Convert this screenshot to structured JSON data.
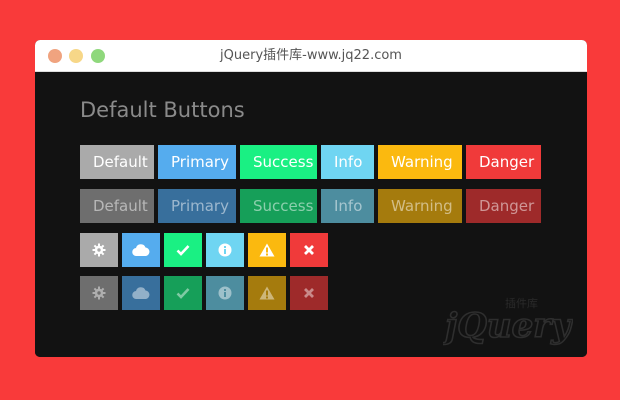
{
  "window": {
    "title": "jQuery插件库-www.jq22.com"
  },
  "heading": "Default Buttons",
  "buttons": [
    {
      "label": "Default",
      "color": "#aaaaaa"
    },
    {
      "label": "Primary",
      "color": "#55acee"
    },
    {
      "label": "Success",
      "color": "#1af083"
    },
    {
      "label": "Info",
      "color": "#6fd5f2"
    },
    {
      "label": "Warning",
      "color": "#fbb90f"
    },
    {
      "label": "Danger",
      "color": "#f03a3a"
    }
  ],
  "disabled_buttons": [
    {
      "label": "Default",
      "color": "#6e6e6e"
    },
    {
      "label": "Primary",
      "color": "#386f9c"
    },
    {
      "label": "Success",
      "color": "#169f59"
    },
    {
      "label": "Info",
      "color": "#4d8d9f"
    },
    {
      "label": "Warning",
      "color": "#a57b0d"
    },
    {
      "label": "Danger",
      "color": "#9e2a2a"
    }
  ],
  "icon_buttons": [
    {
      "icon": "gear-icon",
      "color": "#aaaaaa"
    },
    {
      "icon": "cloud-icon",
      "color": "#55acee"
    },
    {
      "icon": "check-icon",
      "color": "#1af083"
    },
    {
      "icon": "info-icon",
      "color": "#6fd5f2"
    },
    {
      "icon": "warning-icon",
      "color": "#fbb90f"
    },
    {
      "icon": "close-icon",
      "color": "#f03a3a"
    }
  ],
  "disabled_icon_buttons": [
    {
      "icon": "gear-icon",
      "color": "#6e6e6e"
    },
    {
      "icon": "cloud-icon",
      "color": "#386f9c"
    },
    {
      "icon": "check-icon",
      "color": "#169f59"
    },
    {
      "icon": "info-icon",
      "color": "#4d8d9f"
    },
    {
      "icon": "warning-icon",
      "color": "#a57b0d"
    },
    {
      "icon": "close-icon",
      "color": "#9e2a2a"
    }
  ],
  "watermark": {
    "text": "jQuery",
    "subtext": "插件库"
  }
}
